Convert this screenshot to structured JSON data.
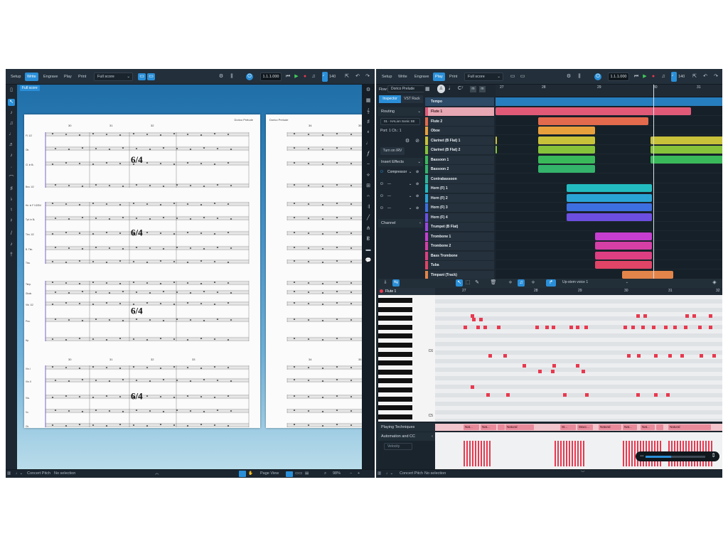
{
  "left": {
    "modes": [
      "Setup",
      "Write",
      "Engrave",
      "Play",
      "Print"
    ],
    "active_mode": "Write",
    "layout": "Full score",
    "position": "1.1.1.000",
    "tempo": "140",
    "tab": "Full score",
    "page1_title": "Dorico Prelude",
    "page2_title": "Dorico Prelude",
    "bars_top": [
      "30",
      "31",
      "32"
    ],
    "bars_top2": [
      "34",
      "35"
    ],
    "bars_bottom": [
      "30",
      "31",
      "32",
      "33"
    ],
    "bars_bottom2": [
      "34",
      "35"
    ],
    "staff_labels_a": [
      "Fl. 1/2",
      "Ob.",
      "Cl. in B♭",
      "Bsn. 1/2"
    ],
    "staff_labels_b": [
      "Hn. in F 1/2/3/4",
      "Tpt. in B♭",
      "Tbn. 1/2",
      "B. Tbn.",
      "Tba."
    ],
    "staff_labels_c": [
      "Timp.",
      "Glock.",
      "Vib. 1/2",
      "Pno.",
      "Hp."
    ],
    "staff_labels_d": [
      "Vln. I",
      "Vln. II",
      "Vla.",
      "Vc.",
      "Cb."
    ],
    "time_sig": "6/4",
    "status": {
      "concert_pitch": "Concert Pitch",
      "selection": "No selection",
      "view": "Page View",
      "zoom": "98%"
    }
  },
  "right": {
    "modes": [
      "Setup",
      "Write",
      "Engrave",
      "Play",
      "Print"
    ],
    "active_mode": "Play",
    "layout": "Full score",
    "position": "1.1.1.000",
    "tempo": "140",
    "flow_label": "Flow:",
    "flow_value": "Dorico Prelude",
    "inspector_tabs": [
      "Inspector",
      "VST Rack"
    ],
    "routing": "Routing",
    "routing_value": "01 - HALion Sonic SE",
    "port_label": "Port:",
    "port_value": "1",
    "ch_label": "Ch.:",
    "ch_value": "1",
    "irv": "Turn on IRV",
    "insert_effects": "Insert Effects",
    "effects": [
      "Compressor",
      "---",
      "---",
      "---"
    ],
    "channel": "Channel",
    "ruler": [
      "27",
      "28",
      "29",
      "30",
      "31"
    ],
    "tempo_track": "Tempo",
    "tracks": [
      {
        "name": "Flute 1",
        "color": "#e05a78"
      },
      {
        "name": "Flute 2",
        "color": "#e36a4c"
      },
      {
        "name": "Oboe",
        "color": "#e8a03c"
      },
      {
        "name": "Clarinet (B Flat) 1",
        "color": "#c8c23a"
      },
      {
        "name": "Clarinet (B Flat) 2",
        "color": "#86c23a"
      },
      {
        "name": "Bassoon 1",
        "color": "#3ab95a"
      },
      {
        "name": "Bassoon 2",
        "color": "#34b36b"
      },
      {
        "name": "Contrabassoon",
        "color": "#2fb59a"
      },
      {
        "name": "Horn (F) 1",
        "color": "#22bcc0"
      },
      {
        "name": "Horn (F) 2",
        "color": "#2aa4d5"
      },
      {
        "name": "Horn (F) 3",
        "color": "#3e6fe0"
      },
      {
        "name": "Horn (F) 4",
        "color": "#6c4fe0"
      },
      {
        "name": "Trumpet (B Flat)",
        "color": "#9b46de"
      },
      {
        "name": "Trombone 1",
        "color": "#c63ecf"
      },
      {
        "name": "Trombone 2",
        "color": "#d63fa6"
      },
      {
        "name": "Bass Trombone",
        "color": "#de3f82"
      },
      {
        "name": "Tuba",
        "color": "#e04466"
      },
      {
        "name": "Timpani (Track)",
        "color": "#e3844a"
      }
    ],
    "pr_track": "Flute 1",
    "voice": "Up-stem voice 1",
    "key_c6": "C6",
    "key_c5": "C5",
    "playing_techniques": "Playing Techniques",
    "techniques": [
      "Nat...",
      "Nat...",
      "",
      "Natural",
      "St...",
      "Stacc...",
      "Natural",
      "Nat...",
      "Nat...",
      "",
      "Natural"
    ],
    "automation": "Automation and CC",
    "velocity": "Velocity",
    "status": {
      "concert_pitch": "Concert Pitch",
      "selection": "No selection"
    }
  }
}
